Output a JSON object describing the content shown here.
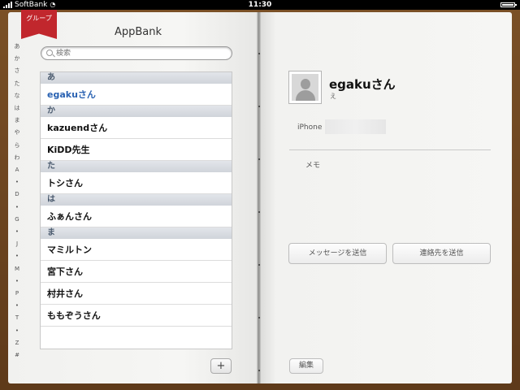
{
  "status_bar": {
    "carrier": "SoftBank",
    "time": "11:30"
  },
  "left_page": {
    "ribbon_label": "グループ",
    "title": "AppBank",
    "search": {
      "placeholder": "検索",
      "value": ""
    },
    "index": [
      "あ",
      "か",
      "さ",
      "た",
      "な",
      "は",
      "ま",
      "や",
      "ら",
      "わ",
      "A",
      "•",
      "D",
      "•",
      "G",
      "•",
      "J",
      "•",
      "M",
      "•",
      "P",
      "•",
      "T",
      "•",
      "Z",
      "#"
    ],
    "sections": [
      {
        "header": "あ",
        "contacts": [
          "egakuさん"
        ]
      },
      {
        "header": "か",
        "contacts": [
          "kazuendさん",
          "KiDD先生"
        ]
      },
      {
        "header": "た",
        "contacts": [
          "トシさん"
        ]
      },
      {
        "header": "は",
        "contacts": [
          "ふぁんさん"
        ]
      },
      {
        "header": "ま",
        "contacts": [
          "マミルトン",
          "宮下さん",
          "村井さん",
          "ももぞうさん"
        ]
      }
    ],
    "selected_contact": "egakuさん",
    "add_label": "+"
  },
  "right_page": {
    "name": "egakuさん",
    "reading": "え",
    "phone_label": "iPhone",
    "memo_label": "メモ",
    "message_button": "メッセージを送信",
    "share_button": "連絡先を送信",
    "edit_button": "編集"
  },
  "colors": {
    "selected_text": "#2a62b2",
    "ribbon": "#c1272d",
    "leather": "#6b4423"
  },
  "icons": {
    "search": "search-icon",
    "avatar": "person-silhouette-icon",
    "add": "plus-icon"
  }
}
